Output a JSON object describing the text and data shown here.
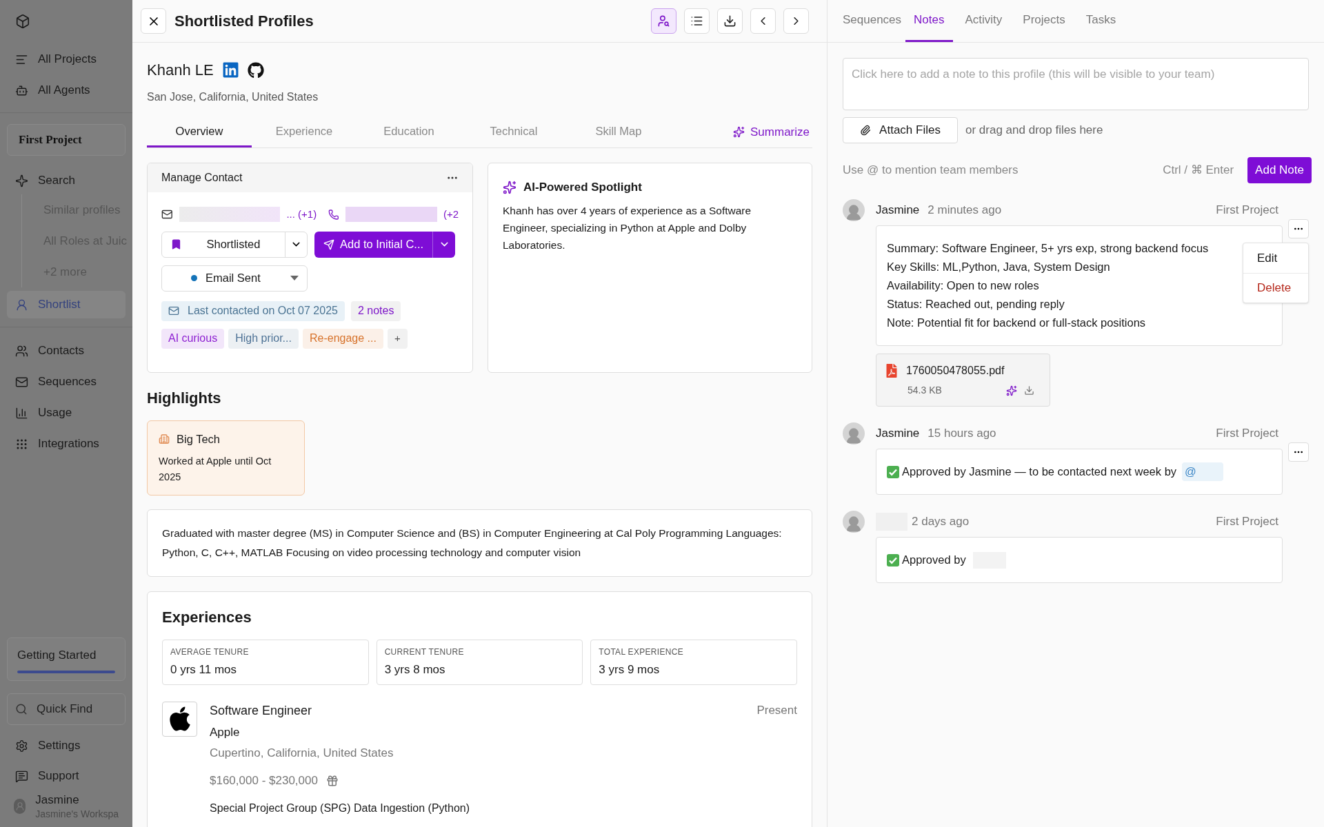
{
  "sidebar": {
    "top_items": [
      {
        "label": "All Projects",
        "selected": false
      },
      {
        "label": "All Agents",
        "selected": false
      }
    ],
    "project": "First Project",
    "nav": [
      {
        "label": "Search",
        "selected": false,
        "children": [
          {
            "label": "Similar profiles"
          },
          {
            "label": "All Roles at Juic"
          },
          {
            "label": "+2 more"
          }
        ]
      },
      {
        "label": "Shortlist",
        "selected": true
      }
    ],
    "tools": [
      {
        "label": "Contacts",
        "selected": false
      },
      {
        "label": "Sequences",
        "selected": false
      },
      {
        "label": "Usage",
        "selected": false
      },
      {
        "label": "Integrations",
        "selected": false
      }
    ],
    "getting_started": {
      "label": "Getting Started",
      "level": 1
    },
    "quick_find": {
      "placeholder": "Quick Find"
    },
    "footer_items": [
      {
        "label": "Settings"
      },
      {
        "label": "Support"
      }
    ],
    "user": {
      "name": "Jasmine",
      "workspace": "Jasmine's Workspa"
    }
  },
  "profile_panel": {
    "title": "Shortlisted Profiles",
    "toolbar": [
      {
        "selected": true
      },
      {
        "selected": false
      },
      {
        "selected": false
      },
      {
        "selected": false
      },
      {
        "selected": false
      }
    ],
    "candidate": {
      "name": "Khanh LE",
      "location": "San Jose, California, United States"
    },
    "tabs": [
      {
        "label": "Overview",
        "selected": true
      },
      {
        "label": "Experience",
        "selected": false
      },
      {
        "label": "Education",
        "selected": false
      },
      {
        "label": "Technical",
        "selected": false
      },
      {
        "label": "Skill Map",
        "selected": false
      }
    ],
    "summarize": "Summarize",
    "manage_contact": {
      "title": "Manage Contact",
      "email_more": "... (+1)",
      "phone_more": "(+2",
      "status": "Shortlisted",
      "action": "Add to Initial C...",
      "outreach": "Email Sent",
      "last_contacted": "Last contacted on Oct 07 2025",
      "notes_count": "2 notes",
      "tags": [
        {
          "label": "AI curious",
          "color": "#8d1fd1"
        },
        {
          "label": "High prior...",
          "color": "#4f7396"
        },
        {
          "label": "Re-engage ...",
          "color": "#d7732c"
        }
      ],
      "add_tag": "+"
    },
    "spotlight": {
      "title": "AI-Powered Spotlight",
      "text": "Khanh has over 4 years of experience as a Software Engineer, specializing in Python at Apple and Dolby Laboratories."
    },
    "highlights": {
      "title": "Highlights",
      "cards": [
        {
          "title": "Big Tech",
          "text": "Worked at Apple until Oct 2025"
        }
      ]
    },
    "education_summary": "Graduated with master degree (MS) in Computer Science and (BS) in Computer Engineering at Cal Poly Programming Languages: Python, C, C++, MATLAB Focusing on video processing technology and computer vision",
    "experiences": {
      "title": "Experiences",
      "stats": [
        {
          "label": "AVERAGE TENURE",
          "value": "0 yrs 11 mos"
        },
        {
          "label": "CURRENT TENURE",
          "value": "3 yrs 8 mos"
        },
        {
          "label": "TOTAL EXPERIENCE",
          "value": "3 yrs 9 mos"
        }
      ],
      "jobs": [
        {
          "title": "Software Engineer",
          "company": "Apple",
          "location": "Cupertino, California, United States",
          "salary": "$160,000 - $230,000",
          "period": "Present",
          "project": "Special Project Group (SPG) Data Ingestion (Python)"
        }
      ]
    }
  },
  "side_panel": {
    "tabs": [
      {
        "label": "Sequences",
        "selected": false
      },
      {
        "label": "Notes",
        "selected": true
      },
      {
        "label": "Activity",
        "selected": false
      },
      {
        "label": "Projects",
        "selected": false
      },
      {
        "label": "Tasks",
        "selected": false
      }
    ],
    "note_editor": {
      "placeholder": "Click here to add a note to this profile (this will be visible to your team)",
      "attach": "Attach Files",
      "drop_hint": "or drag and drop files here",
      "mention_hint": "Use @ to mention team members",
      "shortcut": "Ctrl / ⌘ Enter",
      "submit": "Add Note"
    },
    "notes": [
      {
        "author": "Jasmine",
        "time": "2 minutes ago",
        "project": "First Project",
        "actions_visible": true,
        "lines": [
          "Summary: Software Engineer, 5+ yrs exp, strong backend focus",
          "Key Skills: ML,Python, Java, System Design",
          "Availability: Open to new roles",
          "Status: Reached out, pending reply",
          "Note: Potential fit for backend or full-stack positions"
        ],
        "attachment": {
          "name": "1760050478055.pdf",
          "size": "54.3 KB"
        },
        "menu": [
          {
            "label": "Edit",
            "kind": "normal"
          },
          {
            "label": "Delete",
            "kind": "danger"
          }
        ]
      },
      {
        "author": "Jasmine",
        "time": "15 hours ago",
        "project": "First Project",
        "actions_visible": true,
        "approved": true,
        "text": "Approved by Jasmine — to be contacted next week by",
        "mention": "@"
      },
      {
        "time": "2 days ago",
        "project": "First Project",
        "actions_visible": false,
        "approved": true,
        "text": "Approved by",
        "redacted": true
      }
    ]
  }
}
